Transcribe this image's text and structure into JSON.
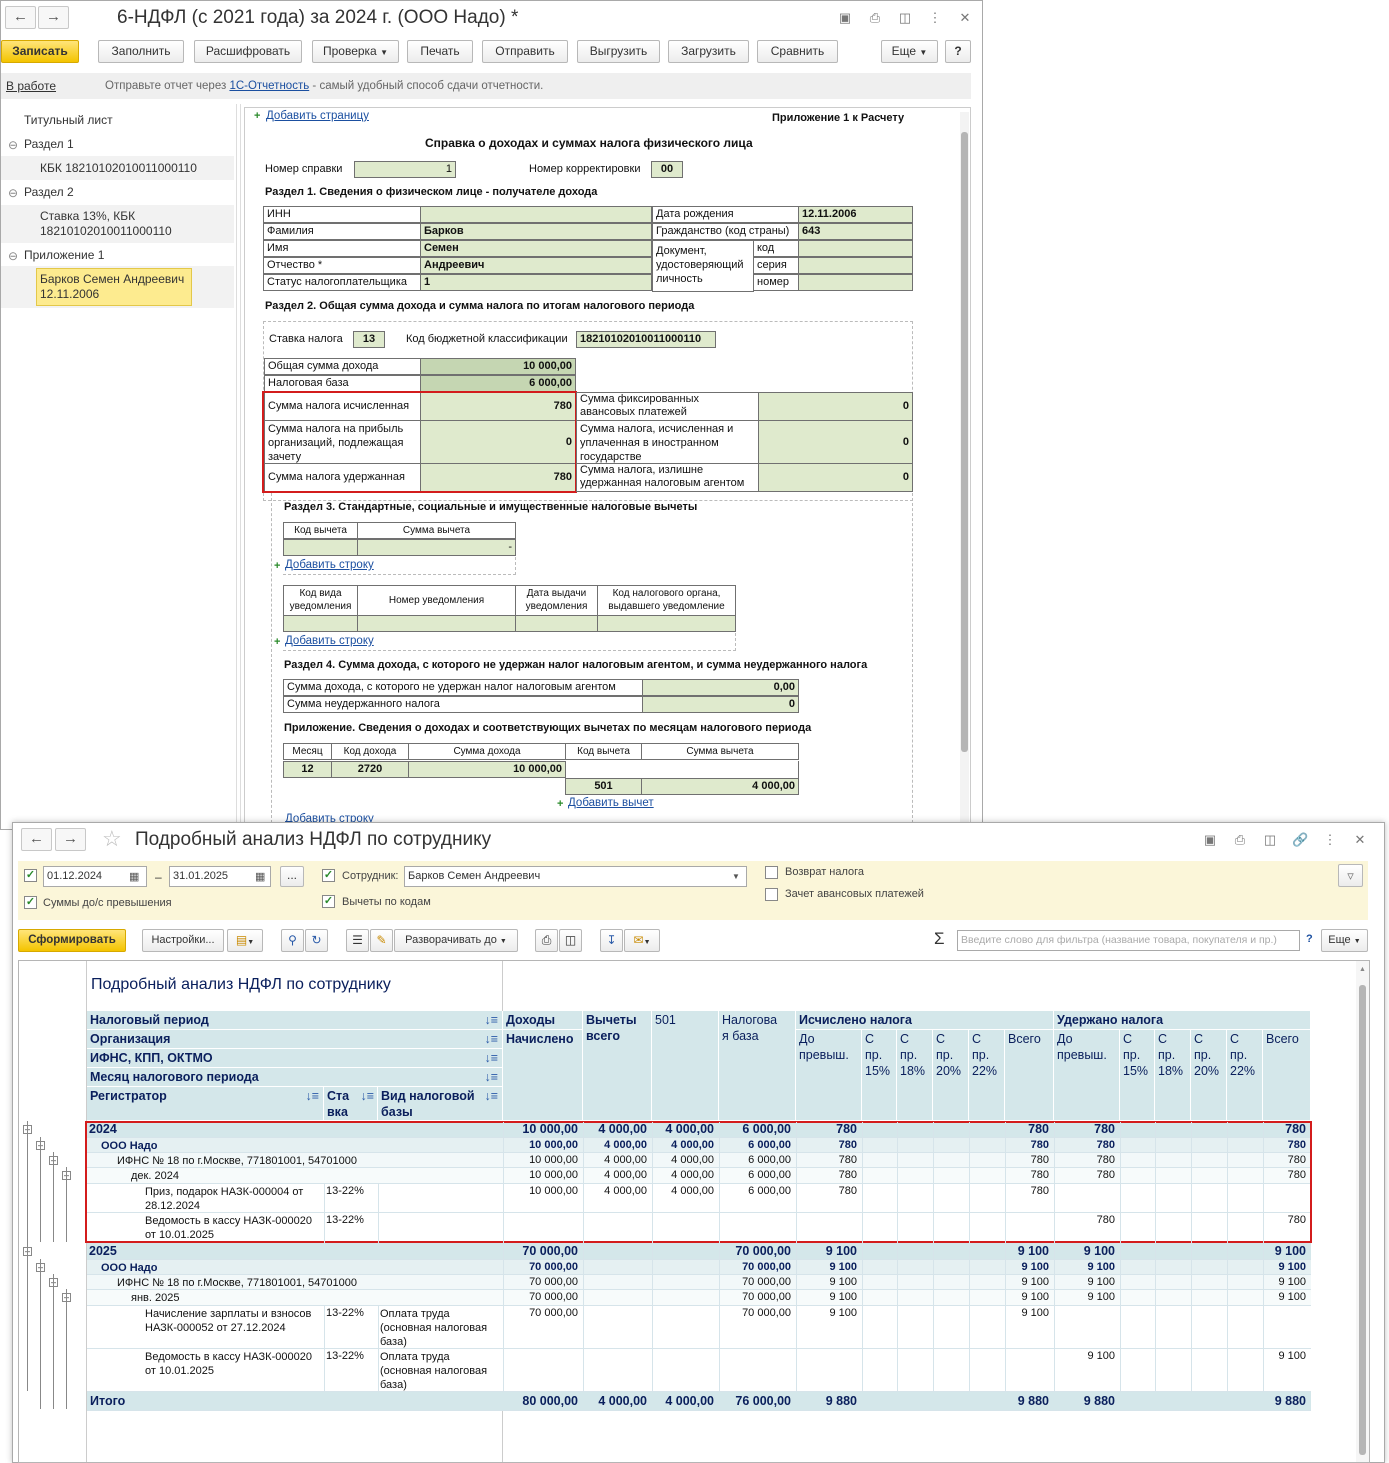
{
  "w1": {
    "title": "6-НДФЛ (с 2021 года) за 2024 г. (ООО Надо) *",
    "toolbar": {
      "save": "Записать",
      "fill": "Заполнить",
      "decode": "Расшифровать",
      "check": "Проверка",
      "print": "Печать",
      "send": "Отправить",
      "export": "Выгрузить",
      "import": "Загрузить",
      "compare": "Сравнить",
      "more": "Еще",
      "help": "?"
    },
    "status": {
      "state": "В работе",
      "prefix": "Отправьте отчет через ",
      "link": "1С-Отчетность",
      "suffix": " - самый удобный способ сдачи отчетности."
    },
    "tree": {
      "title": "Титульный лист",
      "s1": "Раздел 1",
      "s1kbk": "КБК 18210102010011000110",
      "s2": "Раздел 2",
      "s2r1": "Ставка 13%, КБК",
      "s2r2": "18210102010011000110",
      "app": "Приложение 1",
      "person1": "Барков Семен Андреевич",
      "person2": "12.11.2006"
    },
    "form": {
      "add_page": "Добавить страницу",
      "appendix": "Приложение 1 к Расчету",
      "heading": "Справка о доходах и суммах налога физического лица",
      "cert_no_label": "Номер справки",
      "cert_no": "1",
      "corr_label": "Номер корректировки",
      "corr": "00",
      "sec1": "Раздел 1. Сведения о физическом лице - получателе дохода",
      "inn": "ИНН",
      "surname_l": "Фамилия",
      "surname": "Барков",
      "name_l": "Имя",
      "name": "Семен",
      "patr_l": "Отчество *",
      "patr": "Андреевич",
      "status_l": "Статус налогоплательщика",
      "status": "1",
      "dob_l": "Дата рождения",
      "dob": "12.11.2006",
      "citizen_l": "Гражданство (код страны)",
      "citizen": "643",
      "doc1": "Документ,",
      "doc2": "удостоверяющий",
      "doc3": "личность",
      "code": "код",
      "series": "серия",
      "number": "номер",
      "sec2": "Раздел 2. Общая сумма дохода и сумма налога по итогам налогового периода",
      "rate_l": "Ставка налога",
      "rate": "13",
      "kbk_l": "Код бюджетной классификации",
      "kbk": "18210102010011000110",
      "total_income_l": "Общая сумма дохода",
      "total_income": "10 000,00",
      "base_l": "Налоговая база",
      "base": "6 000,00",
      "calc_l": "Сумма налога исчисленная",
      "calc": "780",
      "profit_l1": "Сумма налога на прибыль",
      "profit_l2": "организаций, подлежащая",
      "profit_l3": "зачету",
      "profit": "0",
      "withheld_l": "Сумма налога удержанная",
      "withheld": "780",
      "fixed_l1": "Сумма фиксированных",
      "fixed_l2": "авансовых платежей",
      "fixed": "0",
      "foreign_l1": "Сумма налога, исчисленная и",
      "foreign_l2": "уплаченная в иностранном",
      "foreign_l3": "государстве",
      "foreign": "0",
      "excess_l1": "Сумма налога, излишне",
      "excess_l2": "удержанная налоговым агентом",
      "excess": "0",
      "sec3": "Раздел 3. Стандартные, социальные и имущественные налоговые вычеты",
      "ded_code": "Код вычета",
      "ded_sum": "Сумма вычета",
      "dash": "-",
      "add_row": "Добавить строку",
      "n_type1": "Код вида",
      "n_type2": "уведомления",
      "n_num": "Номер уведомления",
      "n_date1": "Дата выдачи",
      "n_date2": "уведомления",
      "n_org1": "Код налогового органа,",
      "n_org2": "выдавшего уведомление",
      "sec4": "Раздел 4. Сумма дохода, с которого не удержан налог налоговым агентом, и сумма неудержанного налога",
      "nw_income_l": "Сумма дохода, с которого не удержан налог налоговым агентом",
      "nw_income": "0,00",
      "nw_tax_l": "Сумма неудержанного налога",
      "nw_tax": "0",
      "app_title": "Приложение. Сведения о доходах и соответствующих вычетах по месяцам налогового периода",
      "m_month": "Месяц",
      "m_code": "Код дохода",
      "m_sum": "Сумма дохода",
      "m_dcode": "Код вычета",
      "m_dsum": "Сумма вычета",
      "m_v_month": "12",
      "m_v_code": "2720",
      "m_v_sum": "10 000,00",
      "m_v_dcode": "501",
      "m_v_dsum": "4 000,00",
      "add_ded": "Добавить вычет"
    }
  },
  "w2": {
    "title": "Подробный анализ НДФЛ по сотруднику",
    "date_from": "01.12.2024",
    "dash": "–",
    "date_to": "31.01.2025",
    "dots": "...",
    "emp_label": "Сотрудник:",
    "emp": "Барков Семен Андреевич",
    "refund": "Возврат налога",
    "advance": "Зачет авансовых платежей",
    "over": "Суммы до/с превышения",
    "by_codes": "Вычеты по кодам",
    "generate": "Сформировать",
    "settings": "Настройки...",
    "expand": "Разворачивать до",
    "filter_ph": "Введите слово для фильтра (название товара, покупателя и пр.)",
    "more": "Еще",
    "help": "?",
    "report_title": "Подробный анализ НДФЛ по сотруднику",
    "headers": {
      "period": "Налоговый период",
      "org": "Организация",
      "ifns": "ИФНС, КПП, ОКТМО",
      "month": "Месяц налогового периода",
      "reg": "Регистратор",
      "rate1": "Ста",
      "rate2": "вка",
      "type1": "Вид налоговой",
      "type2": "базы",
      "income": "Доходы",
      "accrued": "Начислено",
      "ded1": "Вычеты",
      "ded2": "всего",
      "c501": "501",
      "base1": "Налогова",
      "base2": "я база",
      "calc": "Исчислено налога",
      "held": "Удержано налога",
      "to1": "До",
      "to2": "превыш.",
      "p15a": "С",
      "p15b": "пр.",
      "p15c": "15%",
      "p18c": "18%",
      "p20c": "20%",
      "p22c": "22%",
      "total": "Всего"
    },
    "rows": [
      {
        "label": "2024",
        "lvl": 0,
        "bold": true,
        "big": true,
        "inc": "10 000,00",
        "ded": "4 000,00",
        "c501": "4 000,00",
        "base": "6 000,00",
        "cto": "780",
        "call": "780",
        "hto": "780",
        "hall": "780",
        "rate": "",
        "type": ""
      },
      {
        "label": "ООО Надо",
        "lvl": 1,
        "bold": true,
        "inc": "10 000,00",
        "ded": "4 000,00",
        "c501": "4 000,00",
        "base": "6 000,00",
        "cto": "780",
        "call": "780",
        "hto": "780",
        "hall": "780",
        "rate": "",
        "type": ""
      },
      {
        "label": "ИФНС № 18 по г.Москве, 771801001, 54701000",
        "lvl": 2,
        "inc": "10 000,00",
        "ded": "4 000,00",
        "c501": "4 000,00",
        "base": "6 000,00",
        "cto": "780",
        "call": "780",
        "hto": "780",
        "hall": "780",
        "rate": "",
        "type": ""
      },
      {
        "label": "дек. 2024",
        "lvl": 3,
        "inc": "10 000,00",
        "ded": "4 000,00",
        "c501": "4 000,00",
        "base": "6 000,00",
        "cto": "780",
        "call": "780",
        "hto": "780",
        "hall": "780",
        "rate": "",
        "type": ""
      },
      {
        "label": "Приз, подарок НАЗК-000004 от 28.12.2024",
        "lvl": 4,
        "inc": "10 000,00",
        "ded": "4 000,00",
        "c501": "4 000,00",
        "base": "6 000,00",
        "cto": "780",
        "call": "780",
        "hto": "",
        "hall": "",
        "rate": "13-22%",
        "type": ""
      },
      {
        "label": "Ведомость в кассу НАЗК-000020 от 10.01.2025",
        "lvl": 4,
        "inc": "",
        "ded": "",
        "c501": "",
        "base": "",
        "cto": "",
        "call": "",
        "hto": "780",
        "hall": "780",
        "rate": "13-22%",
        "type": ""
      },
      {
        "label": "2025",
        "lvl": 0,
        "bold": true,
        "big": true,
        "inc": "70 000,00",
        "ded": "",
        "c501": "",
        "base": "70 000,00",
        "cto": "9 100",
        "call": "9 100",
        "hto": "9 100",
        "hall": "9 100",
        "rate": "",
        "type": ""
      },
      {
        "label": "ООО Надо",
        "lvl": 1,
        "bold": true,
        "inc": "70 000,00",
        "ded": "",
        "c501": "",
        "base": "70 000,00",
        "cto": "9 100",
        "call": "9 100",
        "hto": "9 100",
        "hall": "9 100",
        "rate": "",
        "type": ""
      },
      {
        "label": "ИФНС № 18 по г.Москве, 771801001, 54701000",
        "lvl": 2,
        "inc": "70 000,00",
        "ded": "",
        "c501": "",
        "base": "70 000,00",
        "cto": "9 100",
        "call": "9 100",
        "hto": "9 100",
        "hall": "9 100",
        "rate": "",
        "type": ""
      },
      {
        "label": "янв. 2025",
        "lvl": 3,
        "inc": "70 000,00",
        "ded": "",
        "c501": "",
        "base": "70 000,00",
        "cto": "9 100",
        "call": "9 100",
        "hto": "9 100",
        "hall": "9 100",
        "rate": "",
        "type": ""
      },
      {
        "label": "Начисление зарплаты и взносов НАЗК-000052 от 27.12.2024",
        "lvl": 4,
        "inc": "70 000,00",
        "ded": "",
        "c501": "",
        "base": "70 000,00",
        "cto": "9 100",
        "call": "9 100",
        "hto": "",
        "hall": "",
        "rate": "13-22%",
        "type": "Оплата труда (основная налоговая база)"
      },
      {
        "label": "Ведомость в кассу НАЗК-000020 от 10.01.2025",
        "lvl": 4,
        "inc": "",
        "ded": "",
        "c501": "",
        "base": "",
        "cto": "",
        "call": "",
        "hto": "9 100",
        "hall": "9 100",
        "rate": "13-22%",
        "type": "Оплата труда (основная налоговая база)"
      }
    ],
    "total": {
      "label": "Итого",
      "inc": "80 000,00",
      "ded": "4 000,00",
      "c501": "4 000,00",
      "base": "76 000,00",
      "cto": "9 880",
      "call": "9 880",
      "hto": "9 880",
      "hall": "9 880"
    }
  }
}
